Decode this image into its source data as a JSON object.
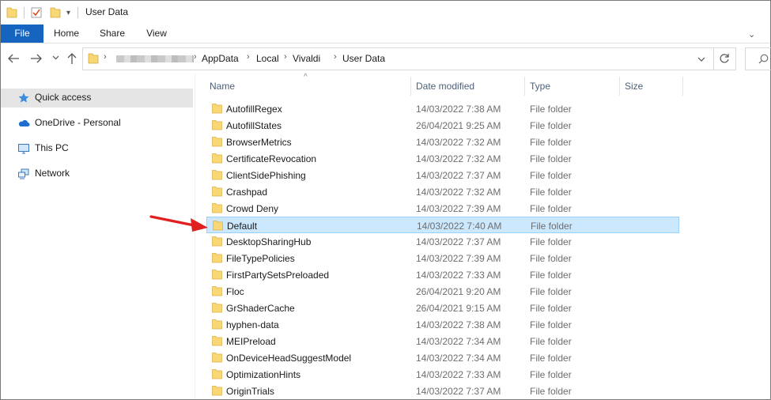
{
  "window": {
    "title": "User Data"
  },
  "ribbon": {
    "tabs": [
      {
        "label": "File"
      },
      {
        "label": "Home"
      },
      {
        "label": "Share"
      },
      {
        "label": "View"
      }
    ]
  },
  "address": {
    "segments": [
      "AppData",
      "Local",
      "Vivaldi",
      "User Data"
    ]
  },
  "navigation": {
    "items": [
      {
        "label": "Quick access",
        "icon": "star-icon"
      },
      {
        "label": "OneDrive - Personal",
        "icon": "cloud-icon"
      },
      {
        "label": "This PC",
        "icon": "monitor-icon"
      },
      {
        "label": "Network",
        "icon": "network-icon"
      }
    ]
  },
  "columns": {
    "name": "Name",
    "date": "Date modified",
    "type": "Type",
    "size": "Size"
  },
  "files": [
    {
      "name": "AutofillRegex",
      "date": "14/03/2022 7:38 AM",
      "type": "File folder"
    },
    {
      "name": "AutofillStates",
      "date": "26/04/2021 9:25 AM",
      "type": "File folder"
    },
    {
      "name": "BrowserMetrics",
      "date": "14/03/2022 7:32 AM",
      "type": "File folder"
    },
    {
      "name": "CertificateRevocation",
      "date": "14/03/2022 7:32 AM",
      "type": "File folder"
    },
    {
      "name": "ClientSidePhishing",
      "date": "14/03/2022 7:37 AM",
      "type": "File folder"
    },
    {
      "name": "Crashpad",
      "date": "14/03/2022 7:32 AM",
      "type": "File folder"
    },
    {
      "name": "Crowd Deny",
      "date": "14/03/2022 7:39 AM",
      "type": "File folder"
    },
    {
      "name": "Default",
      "date": "14/03/2022 7:40 AM",
      "type": "File folder",
      "selected": true
    },
    {
      "name": "DesktopSharingHub",
      "date": "14/03/2022 7:37 AM",
      "type": "File folder"
    },
    {
      "name": "FileTypePolicies",
      "date": "14/03/2022 7:39 AM",
      "type": "File folder"
    },
    {
      "name": "FirstPartySetsPreloaded",
      "date": "14/03/2022 7:33 AM",
      "type": "File folder"
    },
    {
      "name": "Floc",
      "date": "26/04/2021 9:20 AM",
      "type": "File folder"
    },
    {
      "name": "GrShaderCache",
      "date": "26/04/2021 9:15 AM",
      "type": "File folder"
    },
    {
      "name": "hyphen-data",
      "date": "14/03/2022 7:38 AM",
      "type": "File folder"
    },
    {
      "name": "MEIPreload",
      "date": "14/03/2022 7:34 AM",
      "type": "File folder"
    },
    {
      "name": "OnDeviceHeadSuggestModel",
      "date": "14/03/2022 7:34 AM",
      "type": "File folder"
    },
    {
      "name": "OptimizationHints",
      "date": "14/03/2022 7:33 AM",
      "type": "File folder"
    },
    {
      "name": "OriginTrials",
      "date": "14/03/2022 7:37 AM",
      "type": "File folder"
    }
  ],
  "colors": {
    "accent": "#1565c0",
    "selection": "#cce8ff",
    "folder": "#f8d775",
    "arrow": "#e02020"
  }
}
